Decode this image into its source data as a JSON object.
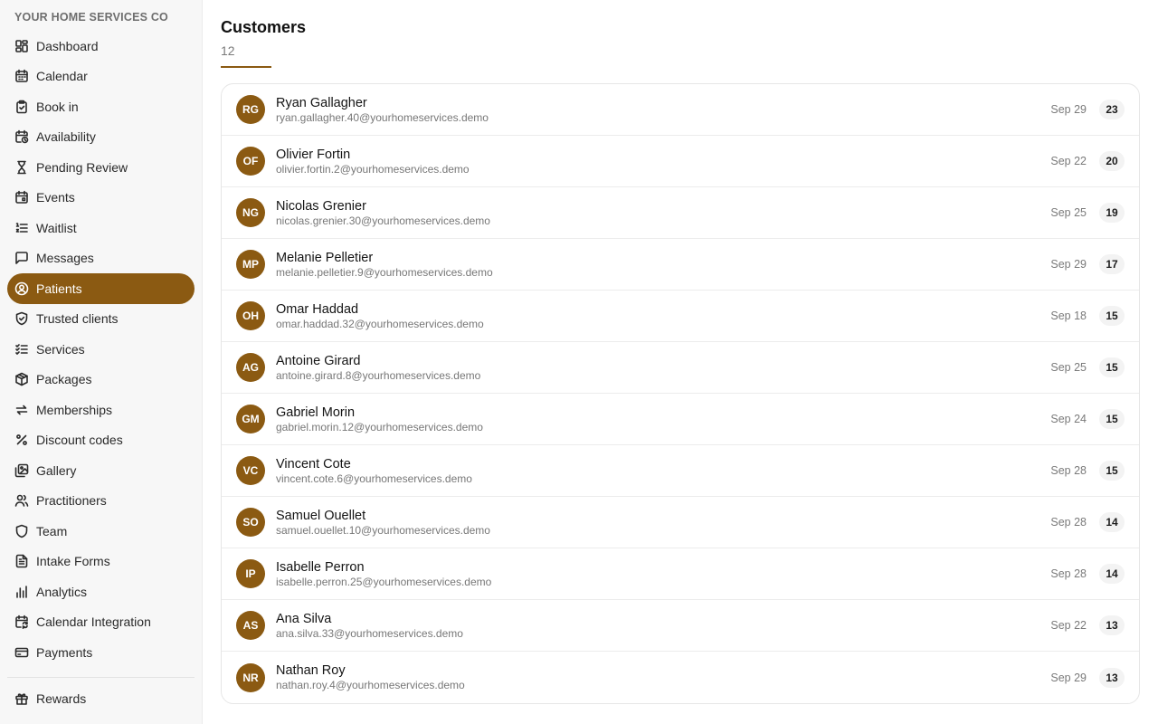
{
  "brand": "YOUR HOME SERVICES CO",
  "nav": [
    {
      "label": "Dashboard",
      "icon": "dashboard-icon"
    },
    {
      "label": "Calendar",
      "icon": "calendar-icon"
    },
    {
      "label": "Book in",
      "icon": "clipboard-icon"
    },
    {
      "label": "Availability",
      "icon": "calendar-clock-icon"
    },
    {
      "label": "Pending Review",
      "icon": "hourglass-icon"
    },
    {
      "label": "Events",
      "icon": "calendar-event-icon"
    },
    {
      "label": "Waitlist",
      "icon": "list-ordered-icon"
    },
    {
      "label": "Messages",
      "icon": "message-icon"
    },
    {
      "label": "Patients",
      "icon": "user-circle-icon",
      "active": true
    },
    {
      "label": "Trusted clients",
      "icon": "shield-check-icon"
    },
    {
      "label": "Services",
      "icon": "list-checks-icon"
    },
    {
      "label": "Packages",
      "icon": "package-icon"
    },
    {
      "label": "Memberships",
      "icon": "repeat-icon"
    },
    {
      "label": "Discount codes",
      "icon": "percent-icon"
    },
    {
      "label": "Gallery",
      "icon": "gallery-icon"
    },
    {
      "label": "Practitioners",
      "icon": "users-icon"
    },
    {
      "label": "Team",
      "icon": "shield-icon"
    },
    {
      "label": "Intake Forms",
      "icon": "file-text-icon"
    },
    {
      "label": "Analytics",
      "icon": "bar-chart-icon"
    },
    {
      "label": "Calendar Integration",
      "icon": "calendar-sync-icon"
    },
    {
      "label": "Payments",
      "icon": "credit-card-icon"
    }
  ],
  "nav_bottom": [
    {
      "label": "Rewards",
      "icon": "gift-icon"
    }
  ],
  "page": {
    "title": "Customers",
    "count": "12"
  },
  "customers": [
    {
      "initials": "RG",
      "name": "Ryan Gallagher",
      "email": "ryan.gallagher.40@yourhomeservices.demo",
      "date": "Sep 29",
      "count": "23"
    },
    {
      "initials": "OF",
      "name": "Olivier Fortin",
      "email": "olivier.fortin.2@yourhomeservices.demo",
      "date": "Sep 22",
      "count": "20"
    },
    {
      "initials": "NG",
      "name": "Nicolas Grenier",
      "email": "nicolas.grenier.30@yourhomeservices.demo",
      "date": "Sep 25",
      "count": "19"
    },
    {
      "initials": "MP",
      "name": "Melanie Pelletier",
      "email": "melanie.pelletier.9@yourhomeservices.demo",
      "date": "Sep 29",
      "count": "17"
    },
    {
      "initials": "OH",
      "name": "Omar Haddad",
      "email": "omar.haddad.32@yourhomeservices.demo",
      "date": "Sep 18",
      "count": "15"
    },
    {
      "initials": "AG",
      "name": "Antoine Girard",
      "email": "antoine.girard.8@yourhomeservices.demo",
      "date": "Sep 25",
      "count": "15"
    },
    {
      "initials": "GM",
      "name": "Gabriel Morin",
      "email": "gabriel.morin.12@yourhomeservices.demo",
      "date": "Sep 24",
      "count": "15"
    },
    {
      "initials": "VC",
      "name": "Vincent Cote",
      "email": "vincent.cote.6@yourhomeservices.demo",
      "date": "Sep 28",
      "count": "15"
    },
    {
      "initials": "SO",
      "name": "Samuel Ouellet",
      "email": "samuel.ouellet.10@yourhomeservices.demo",
      "date": "Sep 28",
      "count": "14"
    },
    {
      "initials": "IP",
      "name": "Isabelle Perron",
      "email": "isabelle.perron.25@yourhomeservices.demo",
      "date": "Sep 28",
      "count": "14"
    },
    {
      "initials": "AS",
      "name": "Ana Silva",
      "email": "ana.silva.33@yourhomeservices.demo",
      "date": "Sep 22",
      "count": "13"
    },
    {
      "initials": "NR",
      "name": "Nathan Roy",
      "email": "nathan.roy.4@yourhomeservices.demo",
      "date": "Sep 29",
      "count": "13"
    }
  ],
  "colors": {
    "accent": "#8b5a12",
    "sidebar_bg": "#f7f7f7"
  }
}
